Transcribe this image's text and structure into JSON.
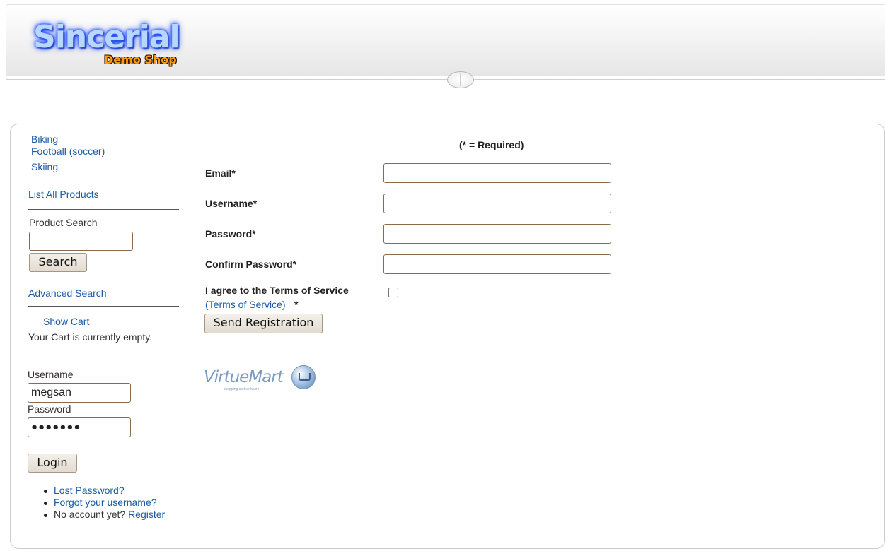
{
  "header": {
    "logo_main": "Sincerial",
    "logo_sub": "Demo Shop"
  },
  "sidebar": {
    "categories": [
      "Biking",
      "Football (soccer)",
      "Skiing"
    ],
    "list_all_products": "List All Products",
    "product_search_label": "Product Search",
    "product_search_value": "",
    "search_button": "Search",
    "advanced_search": "Advanced Search",
    "show_cart": "Show Cart",
    "cart_status": "Your Cart is currently empty.",
    "login": {
      "username_label": "Username",
      "username_value": "megsan",
      "password_label": "Password",
      "password_mask": "●●●●●●●",
      "login_button": "Login"
    },
    "links": {
      "lost_password": "Lost Password?",
      "forgot_username": "Forgot your username?",
      "no_account": "No account yet?",
      "register": "Register"
    }
  },
  "form": {
    "required_note": "(* = Required)",
    "email_label": "Email*",
    "username_label": "Username*",
    "password_label": "Password*",
    "confirm_password_label": "Confirm Password*",
    "email_value": "",
    "username_value": "",
    "password_value": "",
    "confirm_password_value": "",
    "agree_text": "I agree to the Terms of Service",
    "tos_link": "(Terms of Service)",
    "tos_required": "*",
    "agree_checked": false,
    "submit_button": "Send Registration"
  },
  "footer_logo": {
    "text": "VirtueMart",
    "tagline": "shopping cart software"
  }
}
